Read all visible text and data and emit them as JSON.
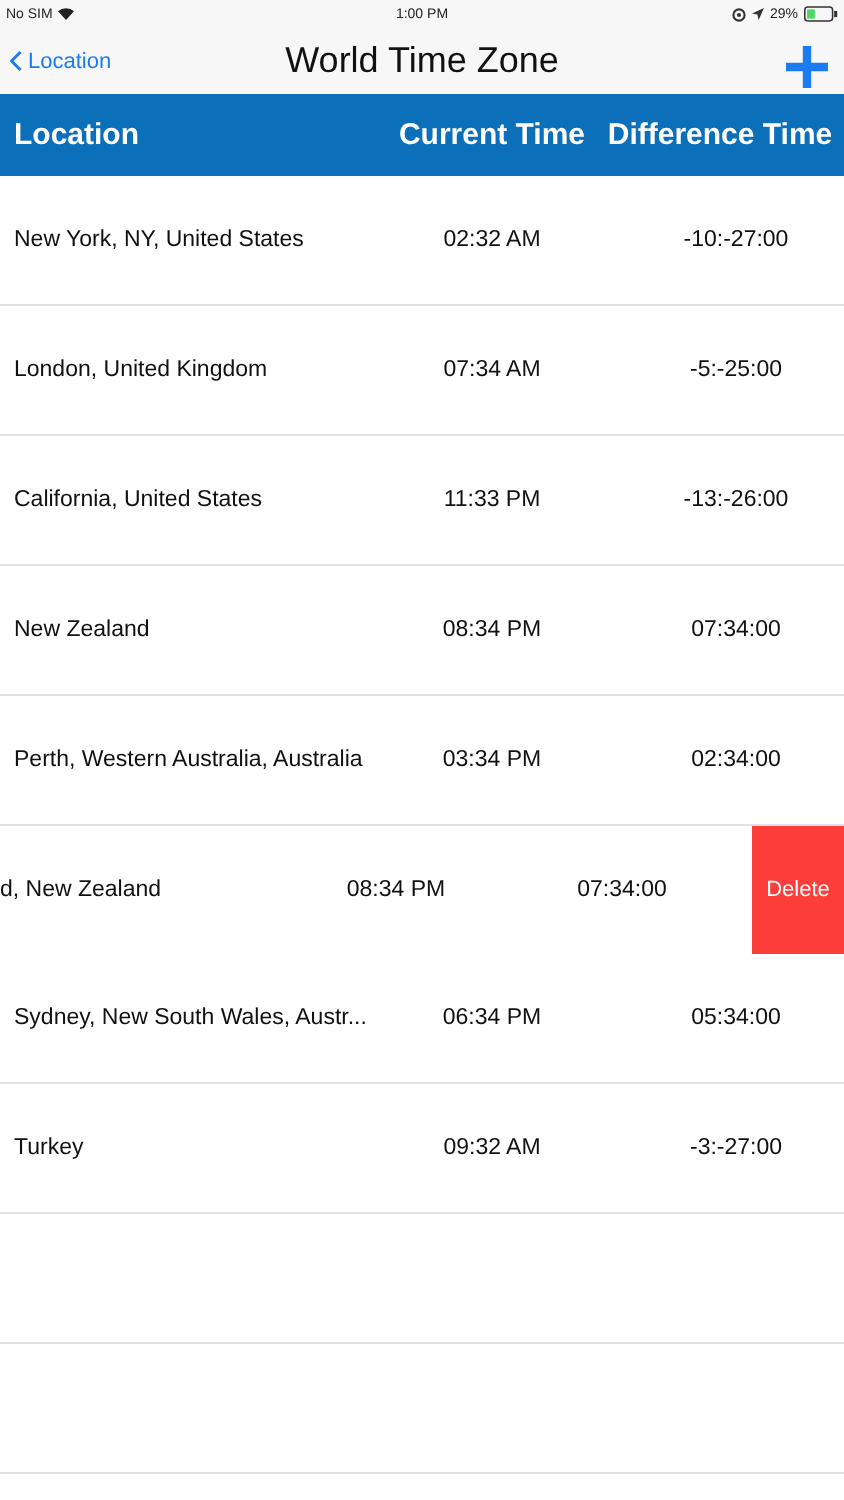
{
  "status_bar": {
    "carrier": "No SIM",
    "time": "1:00 PM",
    "battery": "29%"
  },
  "nav": {
    "back": "Location",
    "title": "World Time Zone"
  },
  "table": {
    "columns": [
      "Location",
      "Current Time",
      "Difference Time"
    ],
    "rows": [
      {
        "location": "New York, NY, United States",
        "current": "02:32 AM",
        "difference": "-10:-27:00",
        "swiped": false
      },
      {
        "location": "London, United Kingdom",
        "current": "07:34 AM",
        "difference": "-5:-25:00",
        "swiped": false
      },
      {
        "location": "California, United States",
        "current": "11:33 PM",
        "difference": "-13:-26:00",
        "swiped": false
      },
      {
        "location": "New Zealand",
        "current": "08:34 PM",
        "difference": "07:34:00",
        "swiped": false
      },
      {
        "location": "Perth, Western Australia, Australia",
        "current": "03:34 PM",
        "difference": "02:34:00",
        "swiped": false
      },
      {
        "location": "d, New Zealand",
        "current": "08:34 PM",
        "difference": "07:34:00",
        "swiped": true,
        "action": "Delete"
      },
      {
        "location": "Sydney, New South Wales, Austr...",
        "current": "06:34 PM",
        "difference": "05:34:00",
        "swiped": false
      },
      {
        "location": "Turkey",
        "current": "09:32 AM",
        "difference": "-3:-27:00",
        "swiped": false
      }
    ]
  }
}
